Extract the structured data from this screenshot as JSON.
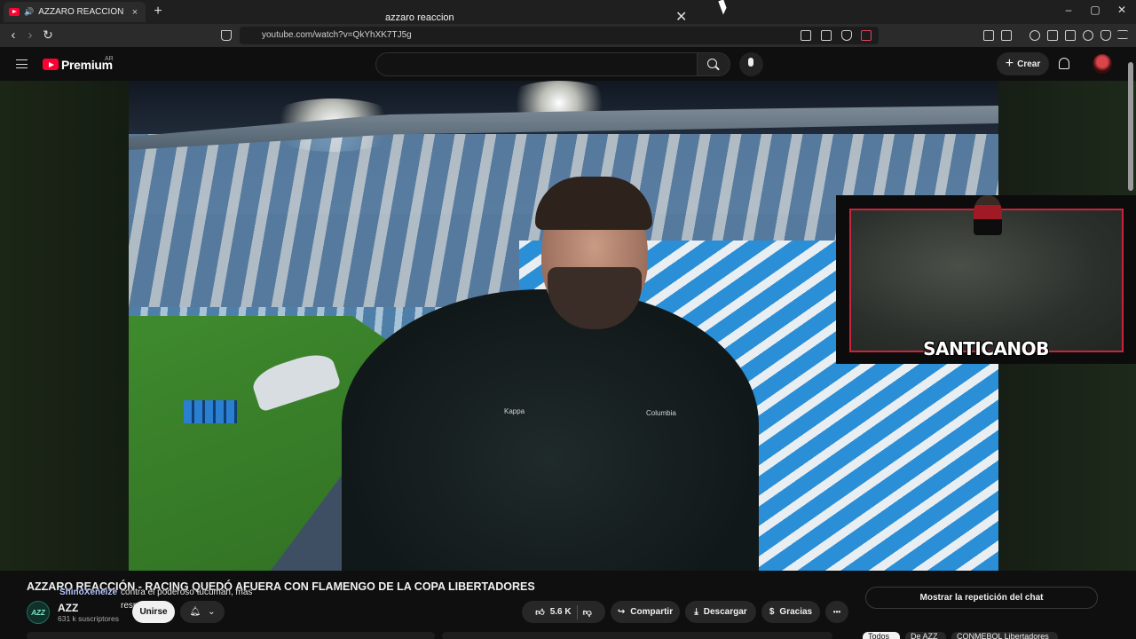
{
  "browser": {
    "tab_title": "AZZARO REACCIÓN - RACING",
    "tab_close": "×",
    "new_tab": "+",
    "url": "youtube.com/watch?v=QkYhXK7TJ5g",
    "back": "‹",
    "forward": "›",
    "reload": "↻",
    "minimize": "–",
    "maximize": "▢",
    "close": "✕"
  },
  "youtube_header": {
    "logo_text": "Premium",
    "region": "AR",
    "search_value": "azzaro reaccion",
    "clear": "✕",
    "create_label": "Crear",
    "create_plus": "+"
  },
  "video": {
    "webcam_name": "SANTICANOB",
    "brand_kappa": "Kappa",
    "brand_columbia": "Columbia"
  },
  "below": {
    "title": "AZZARO REACCIÓN - RACING QUEDÓ AFUERA CON FLAMENGO DE LA COPA LIBERTADORES",
    "chat_user": "ShinoXeneize",
    "chat_text": "contra el poderoso tucuman, mas",
    "chat_text2": "respeto",
    "channel_initials": "AZZ",
    "channel_name": "AZZ",
    "subscribers": "631 k suscriptores",
    "join_label": "Unirse",
    "likes": "5.6 K",
    "share_label": "Compartir",
    "download_label": "Descargar",
    "thanks_label": "Gracias",
    "more": "•••",
    "chat_replay_label": "Mostrar la repetición del chat",
    "chips": [
      "Todos",
      "De AZZ",
      "CONMEBOL Libertadores"
    ]
  },
  "colors": {
    "youtube_red": "#ff0033",
    "webcam_border": "#c9243b",
    "background": "#0f0f0f"
  }
}
